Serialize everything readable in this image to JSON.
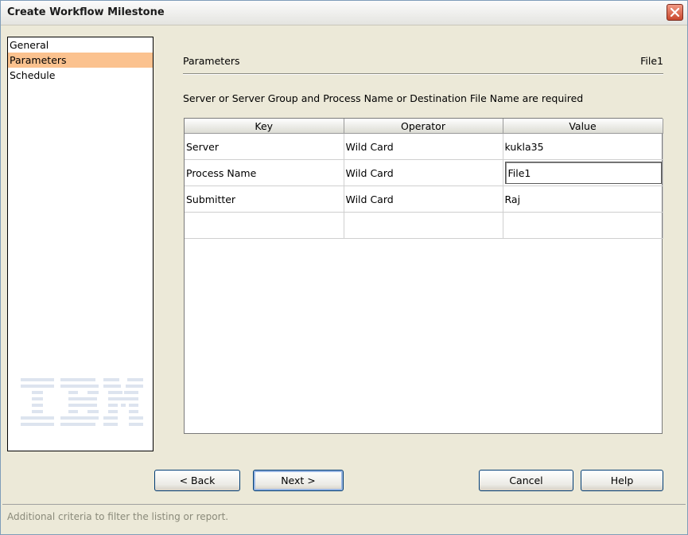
{
  "window": {
    "title": "Create Workflow Milestone",
    "close_icon": "close-icon"
  },
  "nav": {
    "items": [
      {
        "label": "General",
        "selected": false
      },
      {
        "label": "Parameters",
        "selected": true
      },
      {
        "label": "Schedule",
        "selected": false
      }
    ],
    "logo_text": "IBM"
  },
  "panel": {
    "title": "Parameters",
    "file": "File1",
    "requirement": "Server or Server Group and Process Name or Destination File Name are required"
  },
  "table": {
    "headers": [
      "Key",
      "Operator",
      "Value"
    ],
    "rows": [
      {
        "key": "Server",
        "operator": "Wild Card",
        "value": "kukla35"
      },
      {
        "key": "Process Name",
        "operator": "Wild Card",
        "value": "File1"
      },
      {
        "key": "Submitter",
        "operator": "Wild Card",
        "value": "Raj"
      },
      {
        "key": "",
        "operator": "",
        "value": ""
      }
    ]
  },
  "buttons": {
    "back": "< Back",
    "next": "Next >",
    "cancel": "Cancel",
    "help": "Help"
  },
  "status": {
    "text": "Additional criteria to filter the listing or report."
  },
  "colors": {
    "selection": "#fbc28f",
    "status_text": "#8a8a7a",
    "close_button": "#d9573a"
  }
}
